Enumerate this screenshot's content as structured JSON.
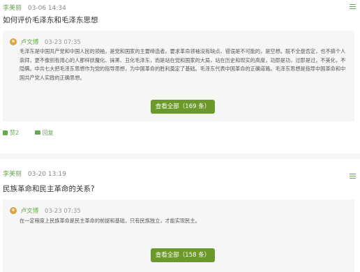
{
  "posts": [
    {
      "author": "李美丽",
      "time": "03-06 14:34",
      "question": "如何评价毛泽东和毛泽东思想",
      "answer": {
        "author": "卢文博",
        "time": "03-23 07:35",
        "text": "毛泽东是中国共产党和中国人民的领袖，是党和国家的主要缔造者。要求革命领袖没有缺点、错误是不可能的，是空想。既不全盘否定，也不搞个人崇拜，更不像别有用心的人那样妖魔化、抹黑、丑化毛泽东，而是站在党和国家的大局，站在历史和现实的高度，功即是功，过即是过，不美化，不隐瞒。中共七大把毛泽东思想作为党的指导思想，为中国革命的胜利奠定了基础。毛泽东代表中国革命的正确道路。毛泽东思想是指导中国革命和中国共产党人实践的正确思想。"
      },
      "view_all": "查看全部（169 条）",
      "like": "赞2",
      "reply": "回复"
    },
    {
      "author": "李美丽",
      "time": "03-20 13:19",
      "question": "民族革命和民主革命的关系?",
      "answer": {
        "author": "卢文博",
        "time": "03-23 07:35",
        "text": "在一定程度上民族革命是民主革命的前提和基础，只有民族独立，才能实现民主。"
      },
      "view_all": "查看全部（158 条）"
    }
  ],
  "colors": {
    "accent": "#6aa84f",
    "button": "#6b9a2b",
    "answer_bg": "#f6f6f6"
  },
  "icons": {
    "menu": "menu-icon",
    "avatar": "avatar",
    "like": "thumb-up-icon",
    "reply": "reply-icon"
  }
}
